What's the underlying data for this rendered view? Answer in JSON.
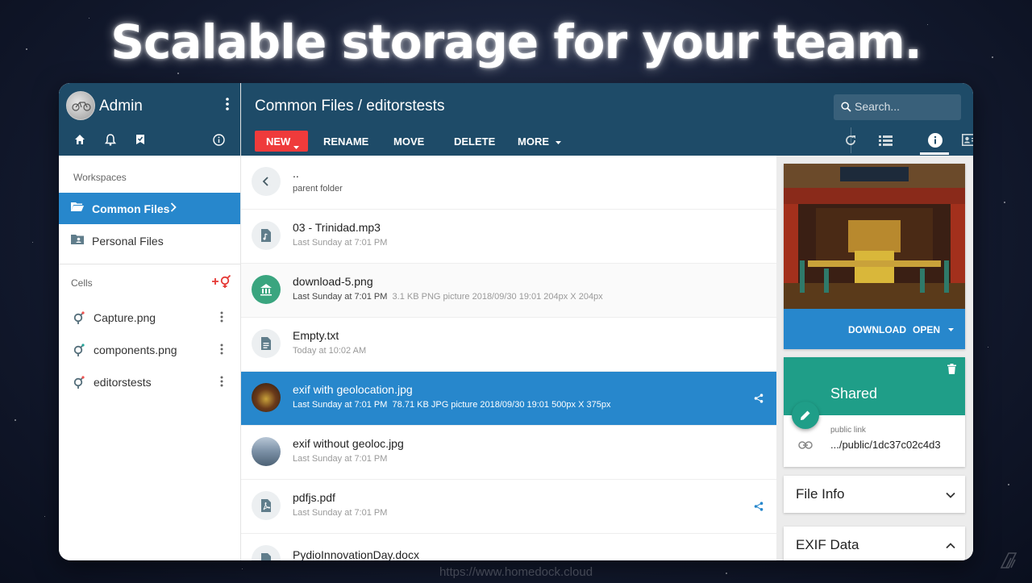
{
  "headline": "Scalable storage for your team.",
  "footer_url": "https://www.homedock.cloud",
  "sidebar": {
    "user_name": "Admin",
    "workspaces_label": "Workspaces",
    "workspaces": [
      {
        "label": "Common Files",
        "active": true
      },
      {
        "label": "Personal Files",
        "active": false
      }
    ],
    "cells_label": "Cells",
    "cells": [
      {
        "label": "Capture.png"
      },
      {
        "label": "components.png"
      },
      {
        "label": "editorstests"
      }
    ]
  },
  "topbar": {
    "breadcrumb": "Common Files / editorstests",
    "search_placeholder": "Search...",
    "new_label": "NEW",
    "rename_label": "RENAME",
    "move_label": "MOVE",
    "delete_label": "DELETE",
    "more_label": "MORE"
  },
  "files": [
    {
      "name": "..",
      "meta": "parent folder"
    },
    {
      "name": "03 - Trinidad.mp3",
      "date": "Last Sunday at 7:01 PM",
      "meta": ""
    },
    {
      "name": "download-5.png",
      "date": "Last Sunday at 7:01 PM",
      "meta": "3.1 KB  PNG picture  2018/09/30 19:01  204px X 204px"
    },
    {
      "name": "Empty.txt",
      "date": "Today at 10:02 AM",
      "meta": ""
    },
    {
      "name": "exif with geolocation.jpg",
      "date": "Last Sunday at 7:01 PM",
      "meta": "78.71 KB  JPG picture  2018/09/30 19:01  500px X 375px",
      "selected": true
    },
    {
      "name": "exif without geoloc.jpg",
      "date": "Last Sunday at 7:01 PM",
      "meta": ""
    },
    {
      "name": "pdfjs.pdf",
      "date": "Last Sunday at 7:01 PM",
      "meta": ""
    },
    {
      "name": "PydioInnovationDay.docx",
      "date": "",
      "meta": ""
    }
  ],
  "panel": {
    "download_label": "DOWNLOAD",
    "open_label": "OPEN",
    "shared_title": "Shared",
    "public_link_label": "public link",
    "public_link_value": ".../public/1dc37c02c4d3",
    "file_info_label": "File Info",
    "exif_label": "EXIF Data"
  },
  "colors": {
    "header": "#1e4b68",
    "accent": "#2787cc",
    "new_button": "#ef3b3b",
    "shared": "#1f9e88"
  }
}
